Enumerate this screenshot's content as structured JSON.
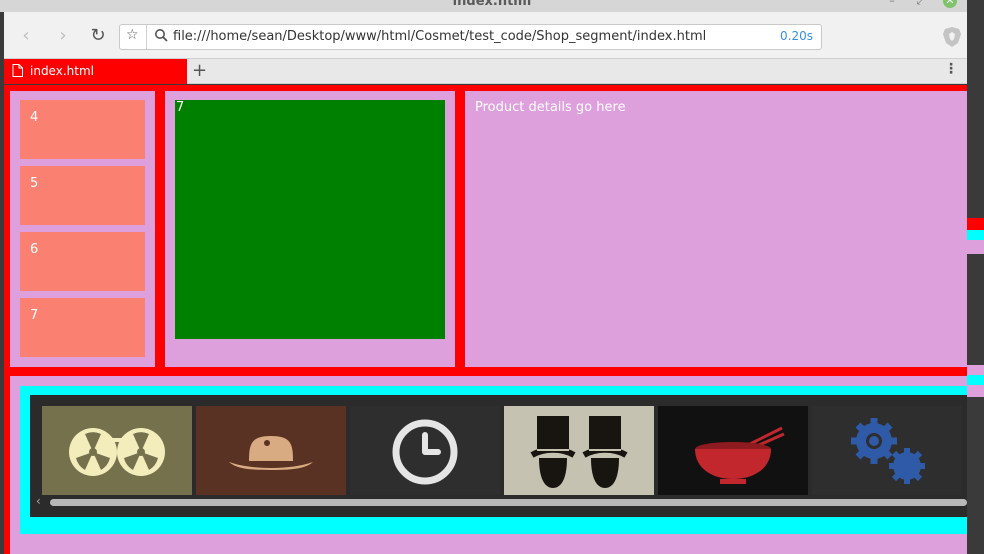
{
  "window": {
    "title": "index.html"
  },
  "toolbar": {
    "url": "file:///home/sean/Desktop/www/html/Cosmet/test_code/Shop_segment/index.html",
    "load_time": "0.20s"
  },
  "tabs": [
    {
      "label": "index.html",
      "active": true
    }
  ],
  "shop": {
    "items": [
      {
        "label": "4"
      },
      {
        "label": "5"
      },
      {
        "label": "6"
      },
      {
        "label": "7"
      }
    ],
    "preview_label": "7",
    "details_text": "Product details go here",
    "carousel": [
      {
        "icon": "film-reels-icon"
      },
      {
        "icon": "cowboy-hat-icon"
      },
      {
        "icon": "clock-icon"
      },
      {
        "icon": "top-hats-icon"
      },
      {
        "icon": "mixing-bowl-icon"
      },
      {
        "icon": "gears-icon"
      }
    ]
  },
  "colors": {
    "frame": "#ff0000",
    "panel": "#dda0dd",
    "item": "#fa8072",
    "preview": "#008000",
    "carousel_border": "#00ffff"
  }
}
